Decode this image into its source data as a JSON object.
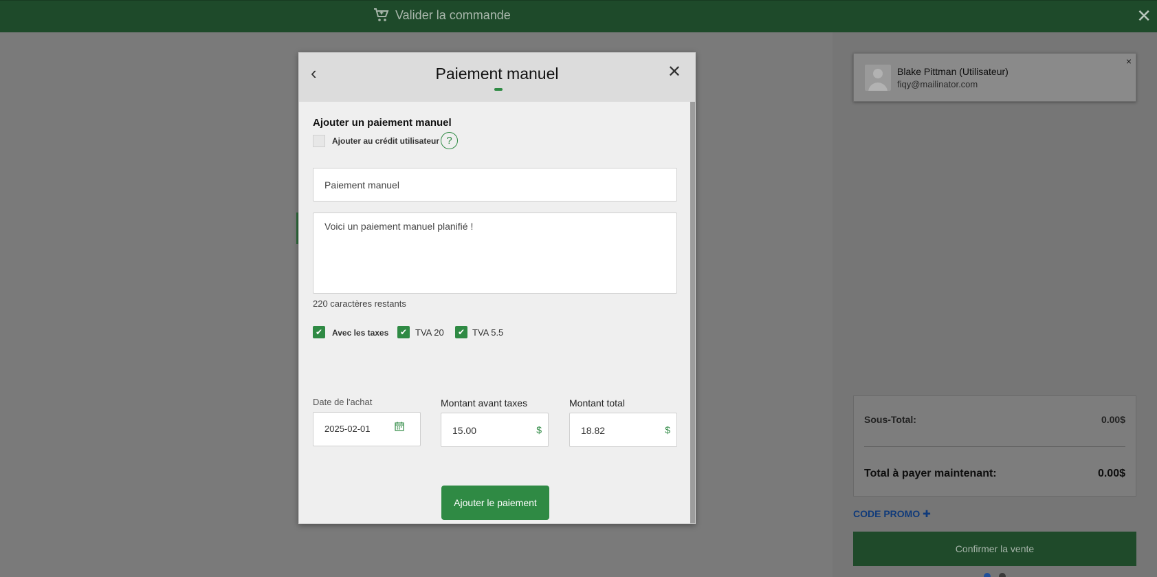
{
  "topbar": {
    "title": "Valider la commande",
    "cart_icon": "cart-icon",
    "close_icon": "close-icon"
  },
  "modal": {
    "title": "Paiement manuel",
    "back_icon": "chevron-left-icon",
    "close_icon": "close-icon",
    "section_title": "Ajouter un paiement manuel",
    "credit_label": "Ajouter au crédit utilisateur",
    "help_symbol": "?",
    "name_value": "Paiement manuel",
    "note_value": "Voici un paiement manuel planifié !",
    "chars_left": "220 caractères restants",
    "taxes": [
      {
        "label": "Avec les taxes",
        "checked": true
      },
      {
        "label": "TVA 20",
        "checked": true
      },
      {
        "label": "TVA 5.5",
        "checked": true
      }
    ],
    "date_label": "Date de l'achat",
    "date_value": "2025-02-01",
    "pretax_label": "Montant avant taxes",
    "pretax_value": "15.00",
    "total_label": "Montant total",
    "total_value": "18.82",
    "currency": "$",
    "submit_label": "Ajouter le paiement",
    "accent_color": "#2f8a44"
  },
  "customer": {
    "name": "Blake Pittman (Utilisateur)",
    "email": "fiqy@mailinator.com",
    "close_symbol": "×"
  },
  "totals": {
    "subtotal_label": "Sous-Total:",
    "subtotal_value": "0.00$",
    "total_label": "Total à payer maintenant:",
    "total_value": "0.00$"
  },
  "promo_label": "CODE PROMO",
  "promo_icon": "plus-icon",
  "confirm_label": "Confirmer la vente"
}
